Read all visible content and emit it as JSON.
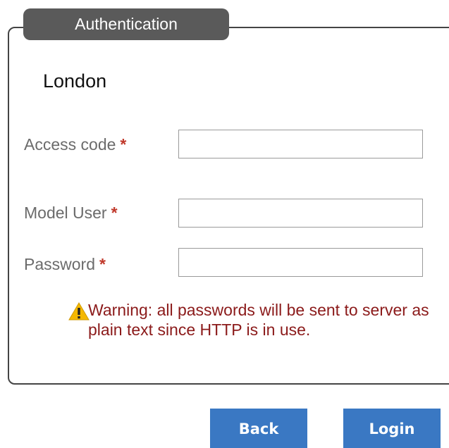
{
  "panel": {
    "title": "Authentication",
    "site_name": "London"
  },
  "form": {
    "fields": [
      {
        "label": "Access code",
        "required_marker": "*",
        "value": "",
        "placeholder": ""
      },
      {
        "label": "Model User",
        "required_marker": "*",
        "value": "",
        "placeholder": ""
      },
      {
        "label": "Password",
        "required_marker": "*",
        "value": "",
        "placeholder": ""
      }
    ]
  },
  "warning": {
    "icon": "warning-triangle-icon",
    "text": "Warning: all passwords will be sent to server as plain text since HTTP is in use."
  },
  "buttons": {
    "back_label": "Back",
    "login_label": "Login"
  },
  "colors": {
    "tab_background": "#5a5a5a",
    "required_marker": "#c0392b",
    "warning_text": "#8b1a1a",
    "warning_icon": "#f5b800",
    "button_background": "#3a78c3"
  }
}
